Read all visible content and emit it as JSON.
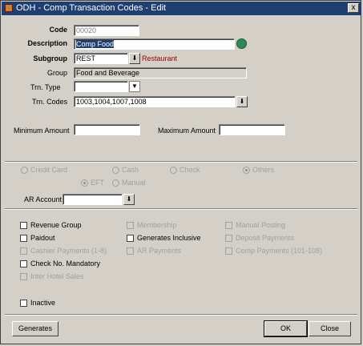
{
  "window": {
    "title": "ODH - Comp Transaction Codes - Edit",
    "close_glyph": "x"
  },
  "form": {
    "code": {
      "label": "Code",
      "value": "00020"
    },
    "description": {
      "label": "Description",
      "value": "Comp Food"
    },
    "subgroup": {
      "label": "Subgroup",
      "value": "REST",
      "caption": "Restaurant"
    },
    "group": {
      "label": "Group",
      "value": "Food and Beverage"
    },
    "trn_type": {
      "label": "Trn. Type",
      "value": ""
    },
    "trn_codes": {
      "label": "Trn. Codes",
      "value": "1003,1004,1007,1008"
    },
    "minimum_amount": {
      "label": "Minimum Amount",
      "value": ""
    },
    "maximum_amount": {
      "label": "Maximum Amount",
      "value": ""
    }
  },
  "payment": {
    "options": [
      "Credit Card",
      "Cash",
      "Check",
      "Others"
    ],
    "selected": "Others",
    "sub_options": [
      "EFT",
      "Manual"
    ],
    "sub_selected": "EFT",
    "ar_account": {
      "label": "AR Account",
      "value": ""
    }
  },
  "checkboxes": {
    "revenue_group": "Revenue Group",
    "membership": "Membership",
    "manual_posting": "Manual Posting",
    "paidout": "Paidout",
    "generates_inclusive": "Generates Inclusive",
    "deposit_payments": "Deposit Payments",
    "cashier_payments": "Cashier Payments (1-8)",
    "ar_payments": "AR Payments",
    "comp_payments": "Comp Payments (101-108)",
    "check_no_mandatory": "Check No. Mandatory",
    "inter_hotel_sales": "Inter Hotel Sales",
    "inactive": "Inactive"
  },
  "buttons": {
    "generates": "Generates",
    "ok": "OK",
    "close": "Close"
  },
  "colors": {
    "title_bar": "#1f3f72",
    "selected_text_bg": "#1f3f72",
    "caption_red": "#a00000"
  }
}
